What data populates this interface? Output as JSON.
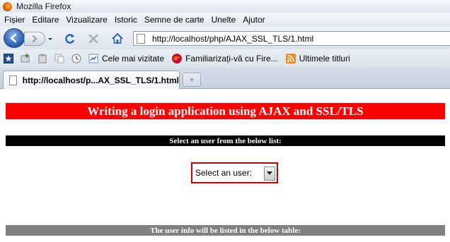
{
  "window": {
    "title": "Mozilla Firefox"
  },
  "menu": {
    "items": [
      "Fișier",
      "Editare",
      "Vizualizare",
      "Istoric",
      "Semne de carte",
      "Unelte",
      "Ajutor"
    ]
  },
  "nav": {
    "url": "http://localhost/php/AJAX_SSL_TLS/1.html",
    "icons": [
      "back-icon",
      "forward-icon",
      "reload-icon",
      "stop-icon",
      "home-icon"
    ]
  },
  "bookmarks": {
    "items": [
      "Cele mai vizitate",
      "Familiarizați-vă cu Fire...",
      "Ultimele titluri"
    ]
  },
  "tab": {
    "label": "http://localhost/p...AX_SSL_TLS/1.html",
    "new_tab_symbol": "+"
  },
  "page": {
    "heading": "Writing a login application using AJAX and SSL/TLS",
    "select_prompt": "Select an user from the below list:",
    "select_label": "Select an user:",
    "table_caption": "The user info will be listed in the below table:",
    "colors": {
      "banner": "#ff0000",
      "subbar": "#000000",
      "footbar": "#808080",
      "select_border": "#cc0000"
    }
  }
}
